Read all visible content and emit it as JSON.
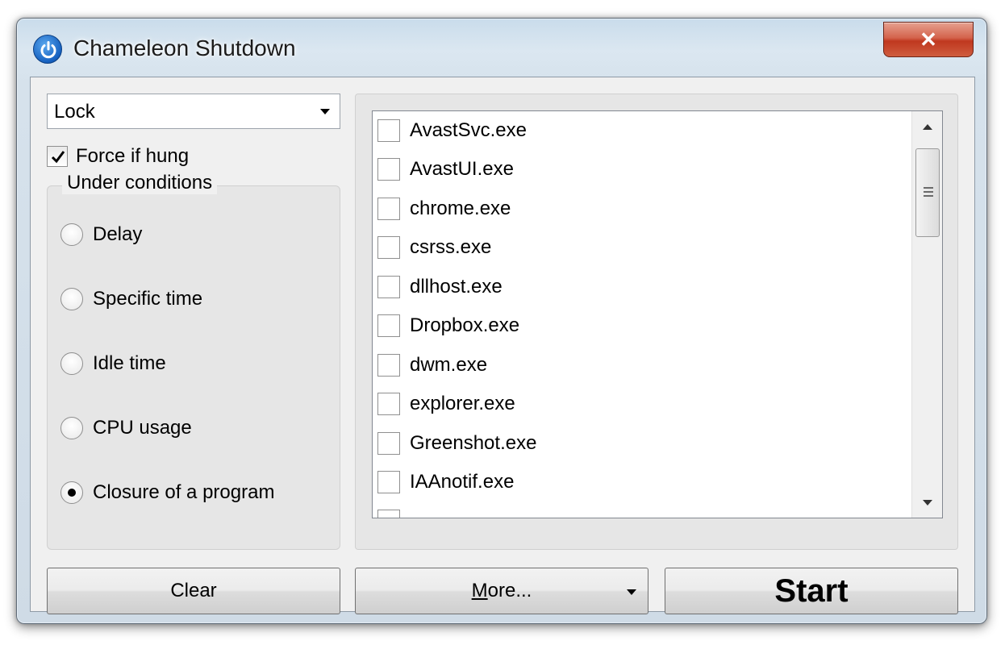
{
  "window": {
    "title": "Chameleon Shutdown",
    "close_label": "✕",
    "colors": {
      "close": "#c7452a",
      "titlebar": "#d6e2ec",
      "client": "#f0f0f0"
    }
  },
  "action_combo": {
    "value": "Lock"
  },
  "force_if_hung": {
    "label": "Force if hung",
    "checked": true
  },
  "conditions": {
    "legend": "Under conditions",
    "options": [
      {
        "label": "Delay",
        "selected": false
      },
      {
        "label": "Specific time",
        "selected": false
      },
      {
        "label": "Idle time",
        "selected": false
      },
      {
        "label": "CPU usage",
        "selected": false
      },
      {
        "label": "Closure of a program",
        "selected": true
      }
    ]
  },
  "process_list": {
    "items": [
      {
        "label": "AvastSvc.exe",
        "checked": false
      },
      {
        "label": "AvastUI.exe",
        "checked": false
      },
      {
        "label": "chrome.exe",
        "checked": false
      },
      {
        "label": "csrss.exe",
        "checked": false
      },
      {
        "label": "dllhost.exe",
        "checked": false
      },
      {
        "label": "Dropbox.exe",
        "checked": false
      },
      {
        "label": "dwm.exe",
        "checked": false
      },
      {
        "label": "explorer.exe",
        "checked": false
      },
      {
        "label": "Greenshot.exe",
        "checked": false
      },
      {
        "label": "IAAnotif.exe",
        "checked": false
      }
    ]
  },
  "buttons": {
    "clear": "Clear",
    "more_mnemonic": "M",
    "more_rest": "ore...",
    "start": "Start"
  }
}
